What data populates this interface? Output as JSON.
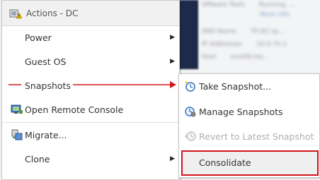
{
  "menu": {
    "header_title": "Actions - DC",
    "items": [
      {
        "label": "Power",
        "has_submenu": true
      },
      {
        "label": "Guest OS",
        "has_submenu": true
      },
      {
        "label": "Snapshots",
        "has_submenu": true
      },
      {
        "label": "Open Remote Console",
        "has_submenu": false,
        "icon": "remote-console-icon"
      },
      {
        "label": "Migrate...",
        "has_submenu": false,
        "icon": "migrate-icon"
      },
      {
        "label": "Clone",
        "has_submenu": true
      }
    ]
  },
  "submenu": {
    "items": [
      {
        "label": "Take Snapshot...",
        "icon": "take-snapshot-icon",
        "enabled": true
      },
      {
        "label": "Manage Snapshots",
        "icon": "manage-snapshots-icon",
        "enabled": true
      },
      {
        "label": "Revert to Latest Snapshot",
        "icon": "revert-snapshot-icon",
        "enabled": false
      },
      {
        "label": "Consolidate",
        "icon": "",
        "enabled": true
      }
    ]
  },
  "background": {
    "rows": [
      {
        "k": "VMware Tools",
        "v": "Running, ..."
      },
      {
        "k": "",
        "v": "More info"
      },
      {
        "k": "DNS Name",
        "v": "TP-DC.tp..."
      },
      {
        "k": "IP Addresses",
        "v": "10.0.70.1"
      },
      {
        "k": "Host",
        "v": "esxi06.tes..."
      }
    ]
  },
  "colors": {
    "annotation_red": "#d0161c",
    "arrow": "#222222"
  }
}
